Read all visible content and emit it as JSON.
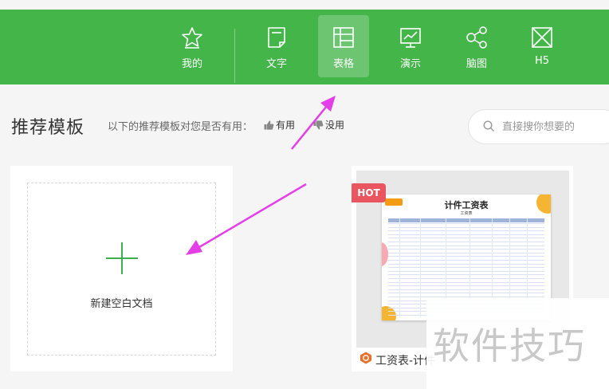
{
  "toolbar": {
    "items": [
      {
        "label": "我的",
        "icon": "star-icon"
      },
      {
        "label": "文字",
        "icon": "document-icon"
      },
      {
        "label": "表格",
        "icon": "table-icon"
      },
      {
        "label": "演示",
        "icon": "presentation-icon"
      },
      {
        "label": "脑图",
        "icon": "mindmap-icon"
      },
      {
        "label": "H5",
        "icon": "h5-icon"
      }
    ],
    "active": "表格",
    "color": "#44b549"
  },
  "section": {
    "title": "推荐模板",
    "feedback_prompt": "以下的推荐模板对您是否有用：",
    "useful_label": "有用",
    "useless_label": "没用"
  },
  "search": {
    "placeholder": "直接搜你想要的"
  },
  "blank_template": {
    "label": "新建空白文档"
  },
  "template_card": {
    "badge": "HOT",
    "name": "工资表-计件",
    "preview_title": "计件工资表",
    "preview_subtitle": "工资表"
  },
  "watermark": {
    "text": "软件技巧"
  },
  "annotation_color": "#e43ee8"
}
